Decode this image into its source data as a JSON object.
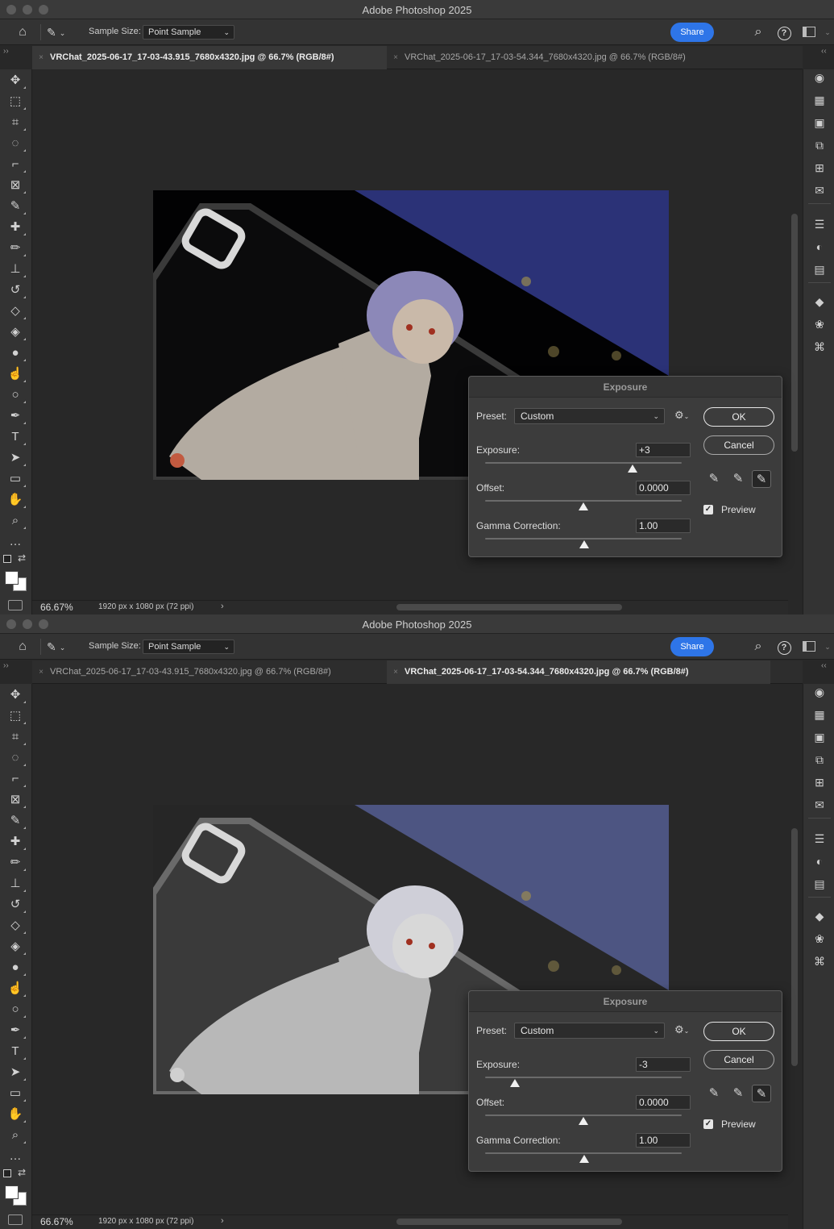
{
  "windows": [
    {
      "app_title": "Adobe Photoshop 2025",
      "sample_size_label": "Sample Size:",
      "sample_size_value": "Point Sample",
      "share_label": "Share",
      "tabs": [
        {
          "label": "VRChat_2025-06-17_17-03-43.915_7680x4320.jpg @ 66.7% (RGB/8#)",
          "active": true
        },
        {
          "label": "VRChat_2025-06-17_17-03-54.344_7680x4320.jpg @ 66.7% (RGB/8#)",
          "active": false
        }
      ],
      "status": {
        "zoom": "66.67%",
        "dimensions": "1920 px x 1080 px (72 ppi)"
      },
      "dialog": {
        "title": "Exposure",
        "preset_label": "Preset:",
        "preset_value": "Custom",
        "exposure_label": "Exposure:",
        "exposure_value": "+3",
        "exposure_slider": 3,
        "offset_label": "Offset:",
        "offset_value": "0.0000",
        "gamma_label": "Gamma Correction:",
        "gamma_value": "1.00",
        "ok_label": "OK",
        "cancel_label": "Cancel",
        "preview_label": "Preview",
        "preview_checked": true
      }
    },
    {
      "app_title": "Adobe Photoshop 2025",
      "sample_size_label": "Sample Size:",
      "sample_size_value": "Point Sample",
      "share_label": "Share",
      "tabs": [
        {
          "label": "VRChat_2025-06-17_17-03-43.915_7680x4320.jpg @ 66.7% (RGB/8#)",
          "active": false
        },
        {
          "label": "VRChat_2025-06-17_17-03-54.344_7680x4320.jpg @ 66.7% (RGB/8#)",
          "active": true
        }
      ],
      "status": {
        "zoom": "66.67%",
        "dimensions": "1920 px x 1080 px (72 ppi)"
      },
      "dialog": {
        "title": "Exposure",
        "preset_label": "Preset:",
        "preset_value": "Custom",
        "exposure_label": "Exposure:",
        "exposure_value": "-3",
        "exposure_slider": -3,
        "offset_label": "Offset:",
        "offset_value": "0.0000",
        "gamma_label": "Gamma Correction:",
        "gamma_value": "1.00",
        "ok_label": "OK",
        "cancel_label": "Cancel",
        "preview_label": "Preview",
        "preview_checked": true
      }
    }
  ],
  "tools": [
    {
      "icon": "move-icon"
    },
    {
      "icon": "marquee-icon"
    },
    {
      "icon": "object-select-icon"
    },
    {
      "icon": "quick-select-icon"
    },
    {
      "icon": "crop-icon"
    },
    {
      "icon": "frame-icon"
    },
    {
      "icon": "eyedropper-icon"
    },
    {
      "icon": "healing-brush-icon"
    },
    {
      "icon": "brush-icon"
    },
    {
      "icon": "clone-stamp-icon"
    },
    {
      "icon": "history-brush-icon"
    },
    {
      "icon": "eraser-icon"
    },
    {
      "icon": "paint-bucket-icon"
    },
    {
      "icon": "blur-icon"
    },
    {
      "icon": "smudge-icon"
    },
    {
      "icon": "dodge-icon"
    },
    {
      "icon": "pen-icon"
    },
    {
      "icon": "type-icon"
    },
    {
      "icon": "path-select-icon"
    },
    {
      "icon": "rectangle-icon"
    },
    {
      "icon": "hand-icon"
    },
    {
      "icon": "zoom-icon"
    },
    {
      "icon": "more-tools-icon"
    }
  ],
  "right_panel_icons": [
    {
      "icon": "color-palette-icon"
    },
    {
      "icon": "swatches-icon"
    },
    {
      "icon": "gradients-icon"
    },
    {
      "icon": "patterns-icon"
    },
    {
      "icon": "grid-icon"
    },
    {
      "icon": "comments-icon"
    },
    {
      "icon": "properties-icon"
    },
    {
      "icon": "adjustments-icon"
    },
    {
      "icon": "libraries-icon"
    },
    {
      "icon": "layers-icon"
    },
    {
      "icon": "channels-icon"
    },
    {
      "icon": "paths-icon"
    }
  ],
  "colors": {
    "accent_share": "#2e75e8",
    "foreground": "#ffffff",
    "background": "#ffffff"
  }
}
